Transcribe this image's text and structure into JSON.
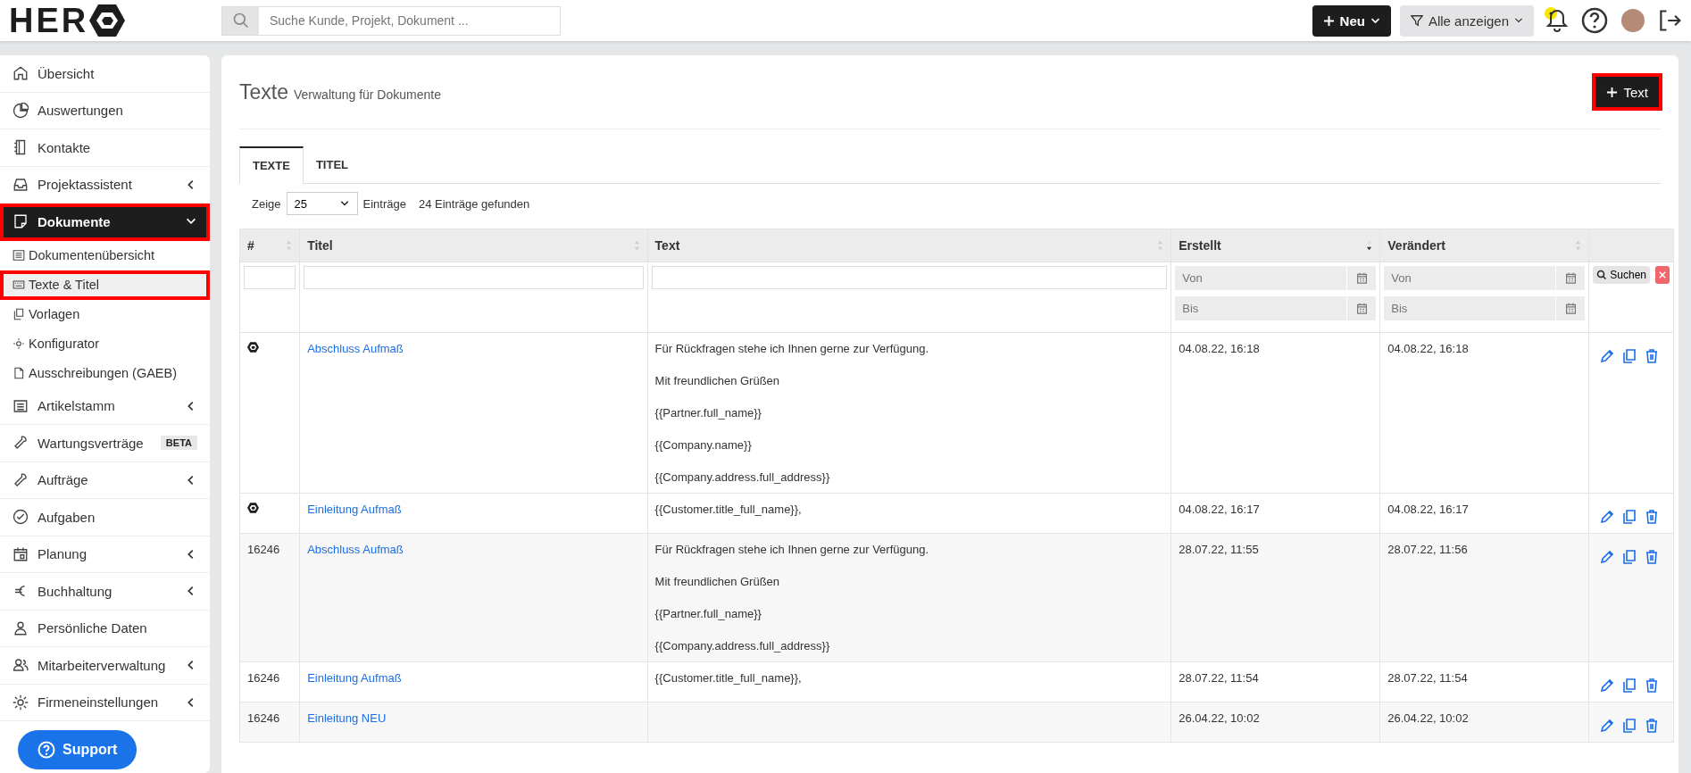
{
  "header": {
    "logo": "HER",
    "search": {
      "placeholder": "Suche Kunde, Projekt, Dokument ..."
    },
    "new_button": "Neu",
    "filter_button": "Alle anzeigen"
  },
  "sidebar": {
    "items": [
      {
        "label": "Übersicht",
        "selected": false
      },
      {
        "label": "Auswertungen",
        "selected": false
      },
      {
        "label": "Kontakte",
        "selected": false
      },
      {
        "label": "Projektassistent",
        "selected": false,
        "expanded": false
      },
      {
        "label": "Dokumente",
        "selected": true,
        "expanded": true,
        "highlighted": true,
        "children": [
          {
            "label": "Dokumentenübersicht",
            "selected": false,
            "highlighted": false
          },
          {
            "label": "Texte & Titel",
            "selected": true,
            "highlighted": true
          },
          {
            "label": "Vorlagen",
            "selected": false,
            "highlighted": false
          },
          {
            "label": "Konfigurator",
            "selected": false,
            "highlighted": false
          },
          {
            "label": "Ausschreibungen (GAEB)",
            "selected": false,
            "highlighted": false
          }
        ]
      },
      {
        "label": "Artikelstamm",
        "selected": false,
        "expanded": false
      },
      {
        "label": "Wartungsverträge",
        "selected": false,
        "badge": "BETA"
      },
      {
        "label": "Aufträge",
        "selected": false,
        "expanded": false
      },
      {
        "label": "Aufgaben",
        "selected": false
      },
      {
        "label": "Planung",
        "selected": false,
        "expanded": false
      },
      {
        "label": "Buchhaltung",
        "selected": false,
        "expanded": false
      },
      {
        "label": "Persönliche Daten",
        "selected": false
      },
      {
        "label": "Mitarbeiterverwaltung",
        "selected": false,
        "expanded": false
      },
      {
        "label": "Firmeneinstellungen",
        "selected": false,
        "expanded": false
      }
    ],
    "support_button": "Support"
  },
  "page": {
    "title": "Texte",
    "subtitle": "Verwaltung für Dokumente",
    "add_button": {
      "label": "Text",
      "highlighted": true
    }
  },
  "tabs": [
    {
      "label": "TEXTE",
      "selected": true
    },
    {
      "label": "TITEL",
      "selected": false
    }
  ],
  "paging": {
    "show_label": "Zeige",
    "page_size": "25",
    "entries_label": "Einträge",
    "found": "24 Einträge gefunden"
  },
  "table": {
    "columns": [
      {
        "label": "#",
        "sorted": false
      },
      {
        "label": "Titel",
        "sorted": false
      },
      {
        "label": "Text",
        "sorted": false
      },
      {
        "label": "Erstellt",
        "sorted": true
      },
      {
        "label": "Verändert",
        "sorted": false
      }
    ],
    "filters": {
      "dates": [
        {
          "from_placeholder": "Von",
          "to_placeholder": "Bis"
        },
        {
          "from_placeholder": "Von",
          "to_placeholder": "Bis"
        }
      ],
      "search_button": "Suchen"
    },
    "rows": [
      {
        "kind": "system",
        "title": "Abschluss Aufmaß",
        "text": [
          "Für Rückfragen stehe ich Ihnen gerne zur Verfügung.",
          "Mit freundlichen Grüßen",
          "{{Partner.full_name}}",
          "{{Company.name}}",
          "{{Company.address.full_address}}"
        ],
        "created": "04.08.22, 16:18",
        "changed": "04.08.22, 16:18"
      },
      {
        "kind": "system",
        "title": "Einleitung Aufmaß",
        "text": [
          "{{Customer.title_full_name}},"
        ],
        "created": "04.08.22, 16:17",
        "changed": "04.08.22, 16:17"
      },
      {
        "kind": "custom",
        "id": "16246",
        "title": "Abschluss Aufmaß",
        "text": [
          "Für Rückfragen stehe ich Ihnen gerne zur Verfügung.",
          "Mit freundlichen Grüßen",
          "{{Partner.full_name}}",
          "{{Company.address.full_address}}"
        ],
        "created": "28.07.22, 11:55",
        "changed": "28.07.22, 11:56"
      },
      {
        "kind": "custom",
        "id": "16246",
        "title": "Einleitung Aufmaß",
        "text": [
          "{{Customer.title_full_name}},"
        ],
        "created": "28.07.22, 11:54",
        "changed": "28.07.22, 11:54"
      },
      {
        "kind": "custom",
        "id": "16246",
        "title": "Einleitung NEU",
        "created": "26.04.22, 10:02",
        "changed": "26.04.22, 10:02"
      }
    ]
  }
}
